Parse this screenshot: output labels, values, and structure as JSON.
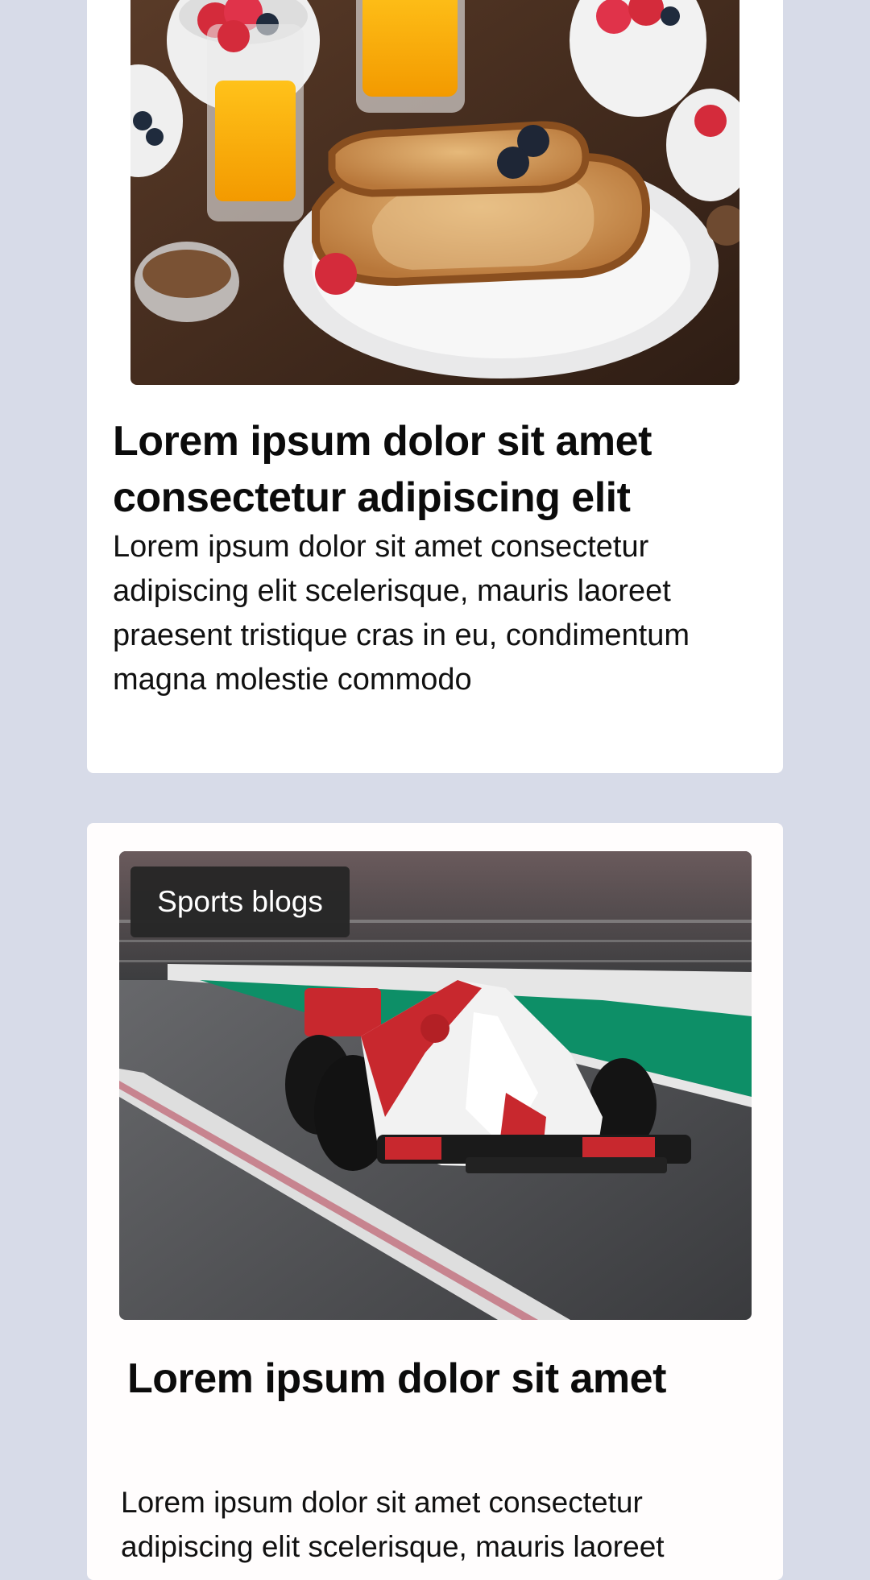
{
  "posts": [
    {
      "image_alt": "Breakfast table with toast, berries and orange juice",
      "title": "Lorem ipsum dolor sit amet consectetur adipiscing elit",
      "excerpt": "Lorem ipsum dolor sit amet consectetur adipiscing elit scelerisque, mauris laoreet praesent tristique cras in eu, condimentum magna molestie commodo"
    },
    {
      "category_badge": "Sports blogs",
      "image_alt": "Formula one race car on track",
      "title": "Lorem ipsum dolor sit amet",
      "excerpt": "Lorem ipsum dolor sit amet consectetur adipiscing elit scelerisque, mauris laoreet"
    }
  ],
  "colors": {
    "page_background": "#d7dbe8",
    "card_background": "#ffffff",
    "badge_background": "#282828",
    "track_green": "#0d8f67",
    "car_red": "#c8282e"
  }
}
